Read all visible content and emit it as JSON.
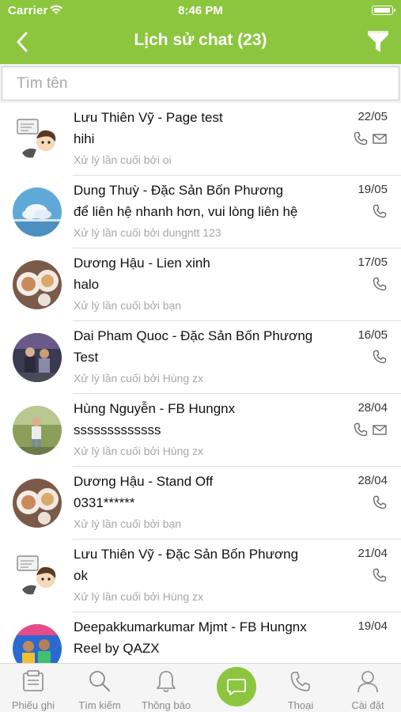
{
  "status_bar": {
    "carrier": "Carrier",
    "time": "8:46 PM"
  },
  "header": {
    "title": "Lịch sử chat (23)",
    "back_icon": "chevron-left-icon",
    "filter_icon": "filter-icon"
  },
  "search": {
    "placeholder": "Tìm tên",
    "value": ""
  },
  "colors": {
    "brand_green": "#8cc63f",
    "handled_text": "#a6a6a6"
  },
  "conversations": [
    {
      "name": "Lưu Thiên Vỹ - Page test",
      "message": "hihi",
      "handled": "Xử lý lần cuối bởi oi",
      "date": "22/05",
      "icons": [
        "phone-icon",
        "mail-icon"
      ],
      "avatar": "cartoon-chat"
    },
    {
      "name": "Dung Thuỳ - Đặc Sản Bốn Phương",
      "message": "để liên hệ nhanh hơn, vui lòng liên hệ",
      "handled": "Xử lý lần cuối bởi dungntt 123",
      "date": "19/05",
      "icons": [
        "phone-icon"
      ],
      "avatar": "sky-clouds"
    },
    {
      "name": "Dương Hậu - Lien xinh",
      "message": "halo",
      "handled": "Xử lý lần cuối bởi bạn",
      "date": "17/05",
      "icons": [
        "phone-icon"
      ],
      "avatar": "food-plates"
    },
    {
      "name": "Dai Pham Quoc - Đặc Sản Bốn Phương",
      "message": "Test",
      "handled": "Xử lý lần cuối bởi Hùng zx",
      "date": "16/05",
      "icons": [
        "phone-icon"
      ],
      "avatar": "group-photo"
    },
    {
      "name": "Hùng Nguyễn - FB Hungnx",
      "message": "sssssssssssss",
      "handled": "Xử lý lần cuối bởi Hùng zx",
      "date": "28/04",
      "icons": [
        "phone-icon",
        "mail-icon"
      ],
      "avatar": "person-outdoor"
    },
    {
      "name": "Dương Hậu - Stand Off",
      "message": "0331******",
      "handled": "Xử lý lần cuối bởi bạn",
      "date": "28/04",
      "icons": [
        "phone-icon"
      ],
      "avatar": "food-plates"
    },
    {
      "name": "Lưu Thiên Vỹ - Đặc Sản Bốn Phương",
      "message": "ok",
      "handled": "Xử lý lần cuối bởi Hùng zx",
      "date": "21/04",
      "icons": [
        "phone-icon"
      ],
      "avatar": "cartoon-chat"
    },
    {
      "name": "Deepakkumarkumar Mjmt - FB Hungnx",
      "message": "Reel by QAZX",
      "handled": "",
      "date": "19/04",
      "icons": [],
      "avatar": "colorful-group"
    }
  ],
  "tabbar": {
    "tabs": [
      {
        "label": "Phiếu ghi",
        "icon": "ticket-icon"
      },
      {
        "label": "Tìm kiếm",
        "icon": "search-icon"
      },
      {
        "label": "Thông báo",
        "icon": "bell-icon"
      },
      {
        "label": "",
        "icon": "chat-bubble-icon",
        "active": true
      },
      {
        "label": "Thoại",
        "icon": "phone-icon"
      },
      {
        "label": "Cài đặt",
        "icon": "user-icon"
      }
    ]
  }
}
